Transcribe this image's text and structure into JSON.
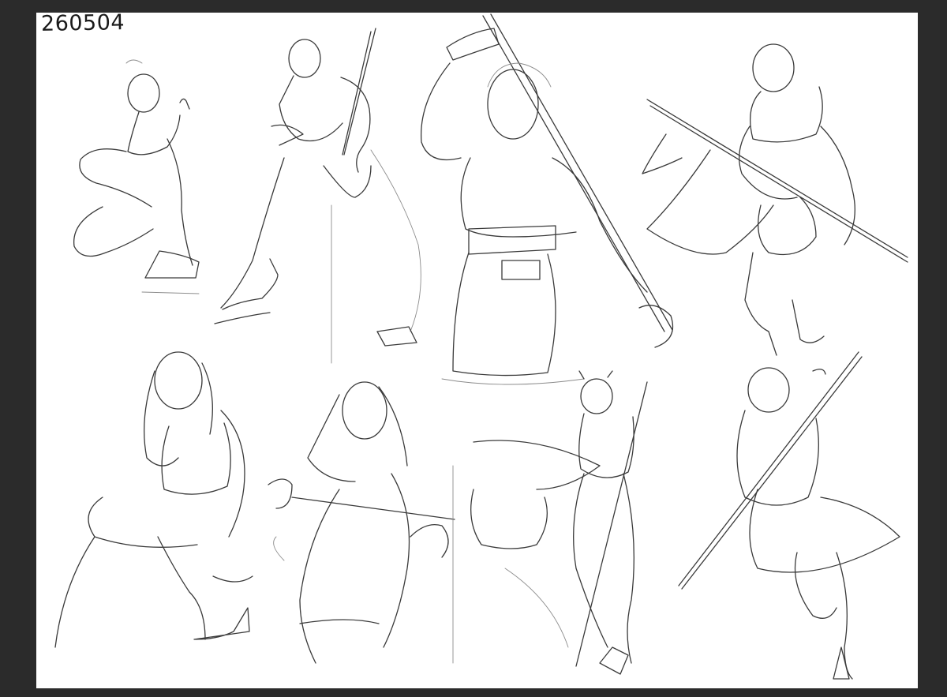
{
  "sheet": {
    "label": "260504",
    "canvas_color": "#ffffff",
    "frame_color": "#2b2b2b",
    "stroke_color": "#3a3a3a"
  },
  "figures": [
    {
      "name": "crouching-figure-sketch"
    },
    {
      "name": "violin-figure-sketch"
    },
    {
      "name": "staff-raised-figure-sketch"
    },
    {
      "name": "spear-kneeling-figure-sketch"
    },
    {
      "name": "seated-figure-sketch"
    },
    {
      "name": "bow-pull-figure-sketch"
    },
    {
      "name": "back-view-figure-sketch"
    },
    {
      "name": "staff-spin-figure-sketch"
    }
  ]
}
